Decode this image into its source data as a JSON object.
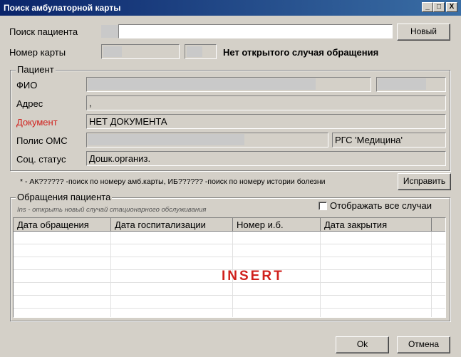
{
  "window": {
    "title": "Поиск амбулаторной карты",
    "btn_min": "_",
    "btn_max": "□",
    "btn_close": "X"
  },
  "search": {
    "label": "Поиск пациента",
    "value": "",
    "new_button": "Новый"
  },
  "card": {
    "label": "Номер карты",
    "status": "Нет открытого случая обращения"
  },
  "patient": {
    "group_title": "Пациент",
    "fio_label": "ФИО",
    "address_label": "Адрес",
    "address_value": ",",
    "document_label": "Документ",
    "document_value": "НЕТ ДОКУМЕНТА",
    "oms_label": "Полис ОМС",
    "insurer_value": "РГС 'Медицина'",
    "social_label": "Соц. статус",
    "social_value": "Дошк.организ.",
    "document_label_color": "#d0201c"
  },
  "hint": {
    "text": "* - АК?????? -поиск по номеру амб.карты, ИБ?????? -поиск по номеру истории болезни",
    "fix_button": "Исправить"
  },
  "visits": {
    "group_title": "Обращения пациента",
    "subtitle": "Ins - открыть новый случай стационарного обслуживания",
    "show_all_label": "Отображать все случаи",
    "show_all_checked": false,
    "columns": [
      "Дата обращения",
      "Дата госпитализации",
      "Номер и.б.",
      "Дата закрытия"
    ],
    "rows": [],
    "overlay_text": "INSERT"
  },
  "footer": {
    "ok_button": "Ok",
    "cancel_button": "Отмена"
  }
}
